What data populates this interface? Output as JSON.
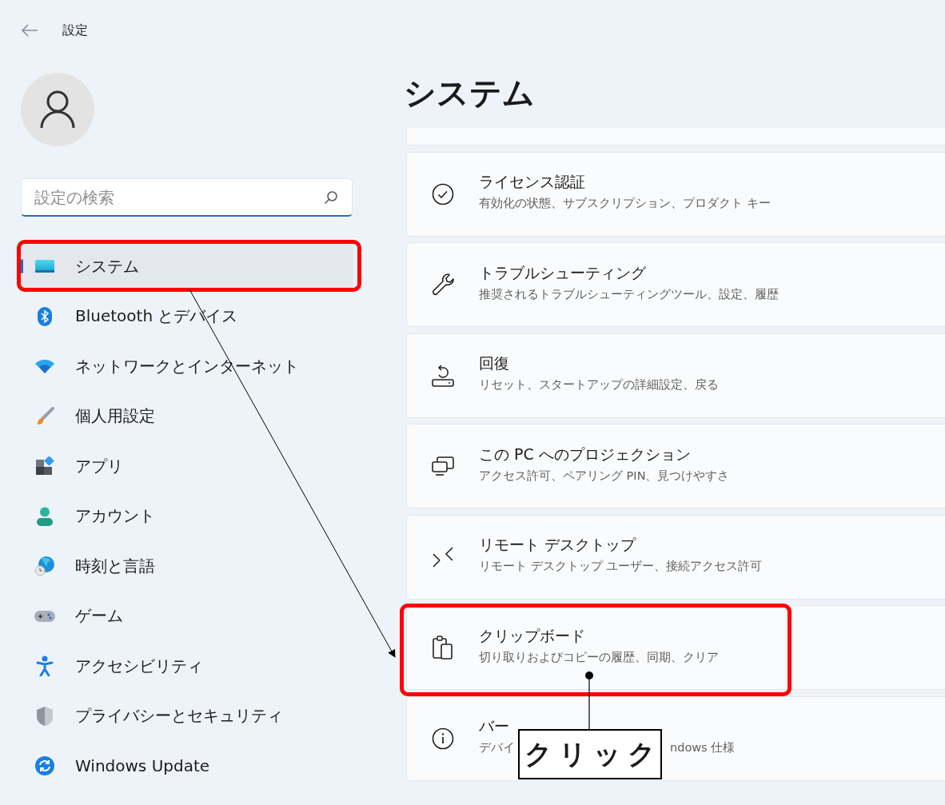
{
  "window": {
    "title": "設定"
  },
  "search": {
    "placeholder": "設定の検索"
  },
  "nav": [
    {
      "label": "システム",
      "selected": true,
      "marked": true
    },
    {
      "label": "Bluetooth とデバイス",
      "selected": false,
      "marked": false
    },
    {
      "label": "ネットワークとインターネット",
      "selected": false,
      "marked": false
    },
    {
      "label": "個人用設定",
      "selected": false,
      "marked": false
    },
    {
      "label": "アプリ",
      "selected": false,
      "marked": false
    },
    {
      "label": "アカウント",
      "selected": false,
      "marked": false
    },
    {
      "label": "時刻と言語",
      "selected": false,
      "marked": false
    },
    {
      "label": "ゲーム",
      "selected": false,
      "marked": false
    },
    {
      "label": "アクセシビリティ",
      "selected": false,
      "marked": false
    },
    {
      "label": "プライバシーとセキュリティ",
      "selected": false,
      "marked": false
    },
    {
      "label": "Windows Update",
      "selected": false,
      "marked": false
    }
  ],
  "page": {
    "title": "システム"
  },
  "cards": [
    {
      "title": "ライセンス認証",
      "subtitle": [
        "有効化の状態、サブスクリプション、プロダクト キー"
      ],
      "marked": false
    },
    {
      "title": "トラブルシューティング",
      "subtitle": [
        "推奨されるトラブルシューティングツール、設定、履歴"
      ],
      "marked": false
    },
    {
      "title": "回復",
      "subtitle": [
        "リセット、スタートアップの詳細設定、戻る"
      ],
      "marked": false
    },
    {
      "title": "この PC へのプロジェクション",
      "subtitle": [
        "アクセス許可、ペアリング PIN、見つけやすさ"
      ],
      "marked": false
    },
    {
      "title": "リモート デスクトップ",
      "subtitle": [
        "リモート デスクトップ ユーザー、接続アクセス許可"
      ],
      "marked": false
    },
    {
      "title": "クリップボード",
      "subtitle": [
        "切り取りおよびコピーの履歴、同期、クリア"
      ],
      "marked": true
    },
    {
      "title": "バー",
      "subtitle": [
        "デバイ",
        "ndows 仕様"
      ],
      "marked": false
    }
  ],
  "callout": {
    "text": "クリック"
  }
}
